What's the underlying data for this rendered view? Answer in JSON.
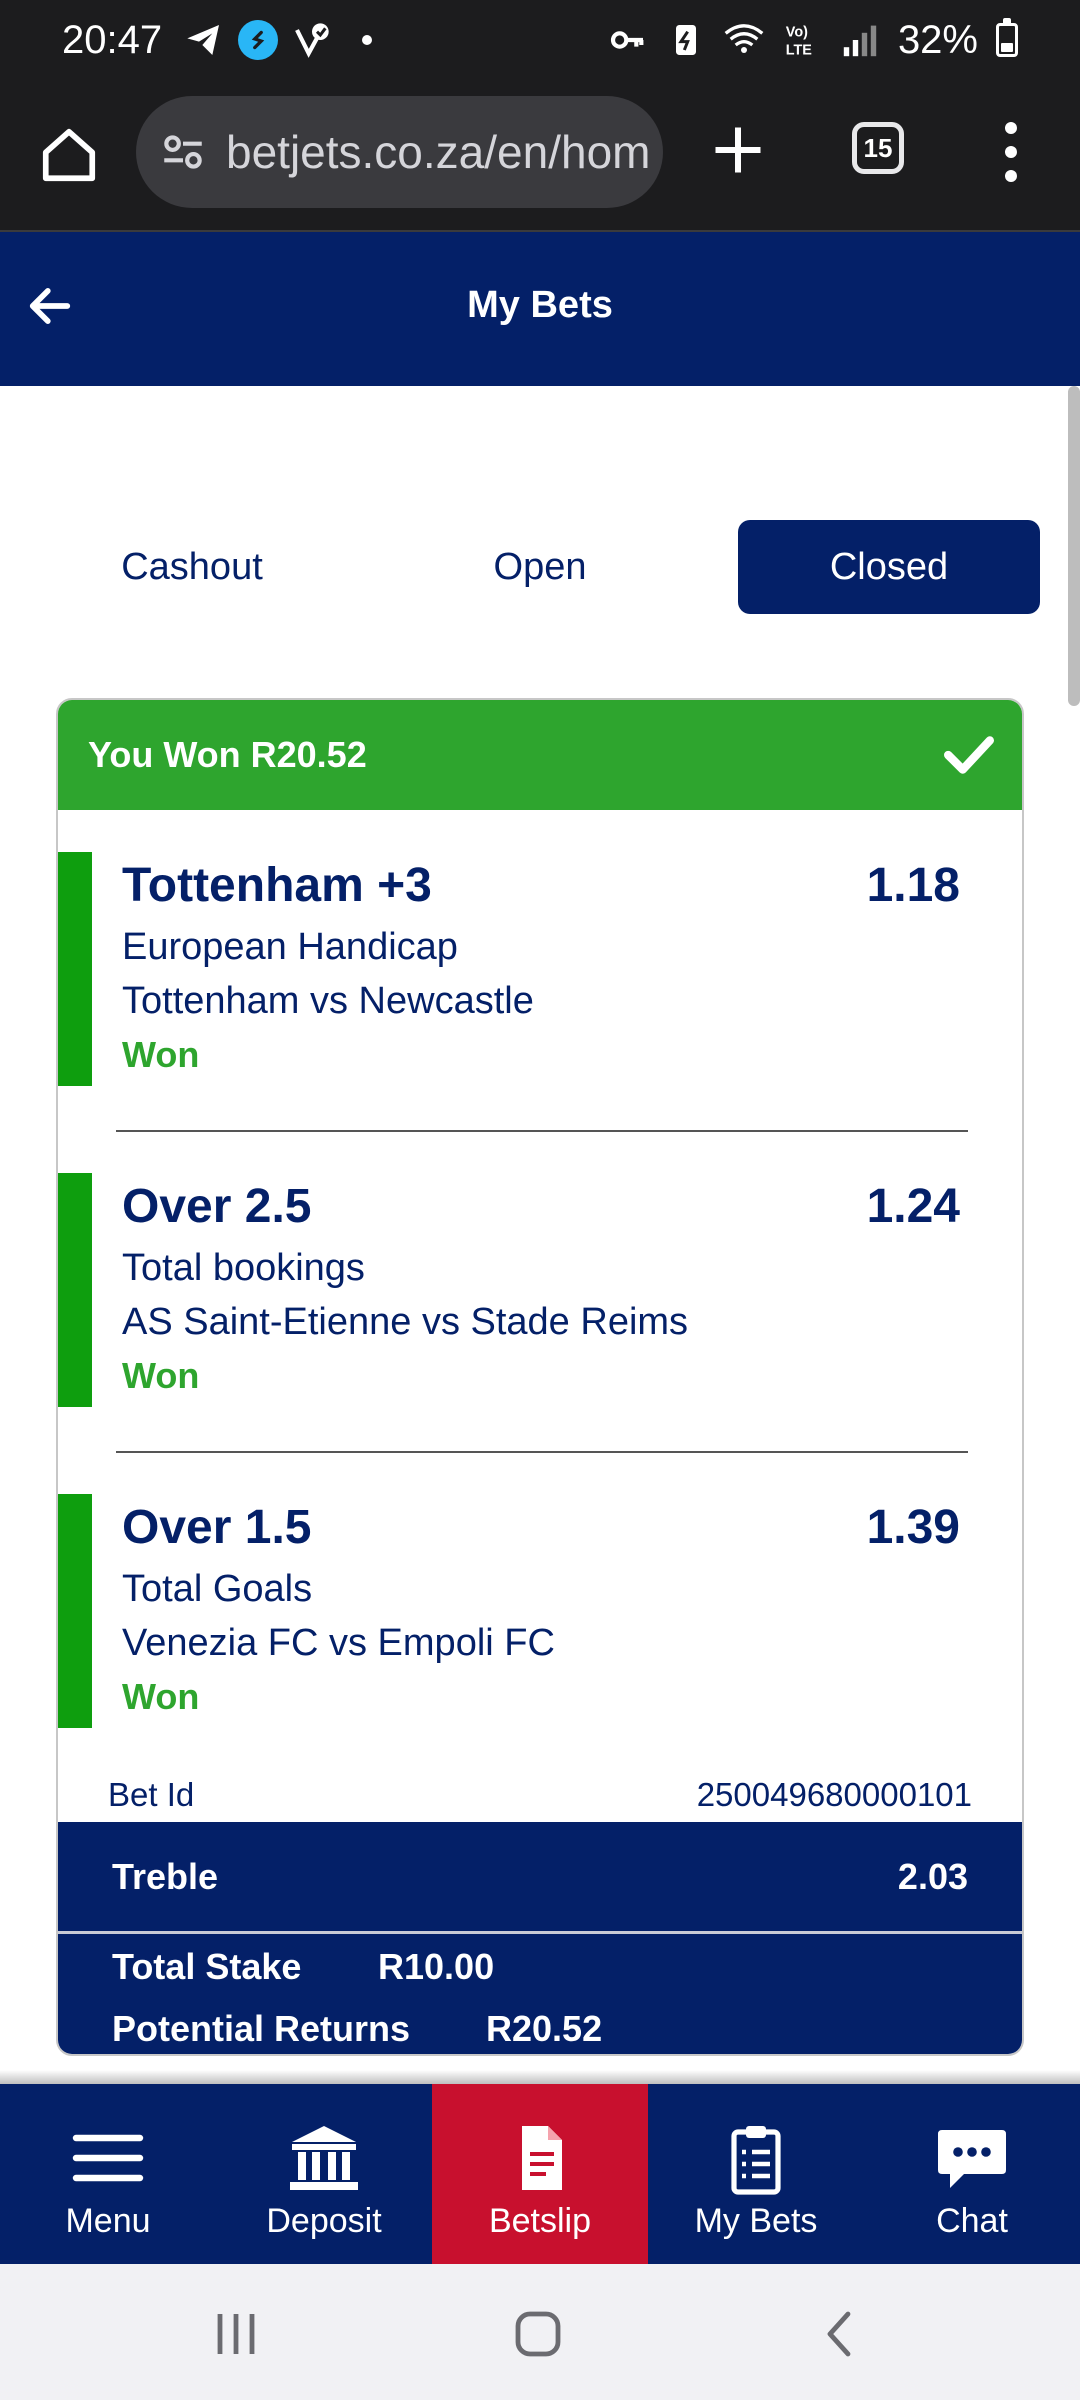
{
  "status_bar": {
    "time": "20:47",
    "battery": "32%",
    "battery_level": 0.32
  },
  "browser": {
    "url": "betjets.co.za/en/hom",
    "tab_count": "15"
  },
  "header": {
    "title": "My Bets"
  },
  "tabs": [
    {
      "label": "Cashout",
      "active": false
    },
    {
      "label": "Open",
      "active": false
    },
    {
      "label": "Closed",
      "active": true
    }
  ],
  "bet": {
    "banner": "You Won R20.52",
    "legs": [
      {
        "selection": "Tottenham +3",
        "odds": "1.18",
        "market": "European Handicap",
        "event": "Tottenham vs Newcastle",
        "result": "Won"
      },
      {
        "selection": "Over 2.5",
        "odds": "1.24",
        "market": "Total bookings",
        "event": "AS Saint-Etienne vs Stade Reims",
        "result": "Won"
      },
      {
        "selection": "Over 1.5",
        "odds": "1.39",
        "market": "Total Goals",
        "event": "Venezia FC vs Empoli FC",
        "result": "Won"
      }
    ],
    "bet_id_label": "Bet Id",
    "bet_id": "250049680000101",
    "type_label": "Treble",
    "total_odds": "2.03",
    "total_stake_label": "Total Stake",
    "total_stake": "R10.00",
    "potential_returns_label": "Potential Returns",
    "potential_returns": "R20.52"
  },
  "bottom_nav": [
    {
      "label": "Menu",
      "icon": "hamburger-icon",
      "active": false
    },
    {
      "label": "Deposit",
      "icon": "bank-icon",
      "active": false
    },
    {
      "label": "Betslip",
      "icon": "document-icon",
      "active": true
    },
    {
      "label": "My Bets",
      "icon": "clipboard-icon",
      "active": false
    },
    {
      "label": "Chat",
      "icon": "chat-bubble-icon",
      "active": false
    }
  ],
  "colors": {
    "primary": "#042068",
    "success": "#2ea52e",
    "leg_bar": "#0e9e0e",
    "active_nav": "#c8102e"
  }
}
